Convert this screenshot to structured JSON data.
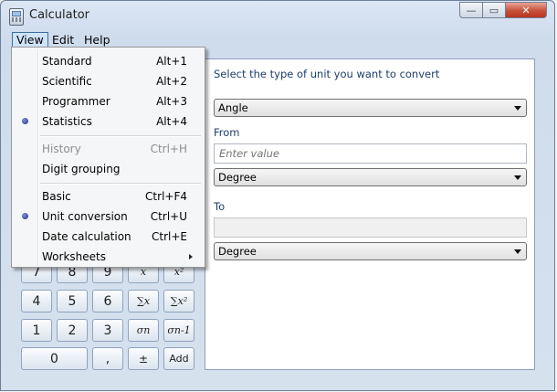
{
  "window": {
    "title": "Calculator",
    "controls": {
      "minimize": "—",
      "maximize": "▭",
      "close": "✕"
    }
  },
  "menubar": {
    "view": "View",
    "edit": "Edit",
    "help": "Help"
  },
  "view_menu": {
    "items": [
      {
        "label": "Standard",
        "shortcut": "Alt+1"
      },
      {
        "label": "Scientific",
        "shortcut": "Alt+2"
      },
      {
        "label": "Programmer",
        "shortcut": "Alt+3"
      },
      {
        "label": "Statistics",
        "shortcut": "Alt+4",
        "selected": true
      },
      {
        "label": "History",
        "shortcut": "Ctrl+H",
        "disabled": true
      },
      {
        "label": "Digit grouping",
        "shortcut": ""
      },
      {
        "label": "Basic",
        "shortcut": "Ctrl+F4"
      },
      {
        "label": "Unit conversion",
        "shortcut": "Ctrl+U",
        "selected": true
      },
      {
        "label": "Date calculation",
        "shortcut": "Ctrl+E"
      },
      {
        "label": "Worksheets",
        "shortcut": "",
        "submenu": true
      }
    ]
  },
  "keypad": {
    "row1": [
      "7",
      "8",
      "9",
      "x",
      "x²"
    ],
    "row2": [
      "4",
      "5",
      "6",
      "∑x",
      "∑x²"
    ],
    "row3": [
      "1",
      "2",
      "3",
      "σn",
      "σn-1"
    ],
    "row4": [
      "0",
      ",",
      "±",
      "Add"
    ]
  },
  "unit_conversion": {
    "prompt": "Select the type of unit you want to convert",
    "type_selected": "Angle",
    "from_label": "From",
    "from_placeholder": "Enter value",
    "from_unit": "Degree",
    "to_label": "To",
    "to_value": "",
    "to_unit": "Degree"
  }
}
